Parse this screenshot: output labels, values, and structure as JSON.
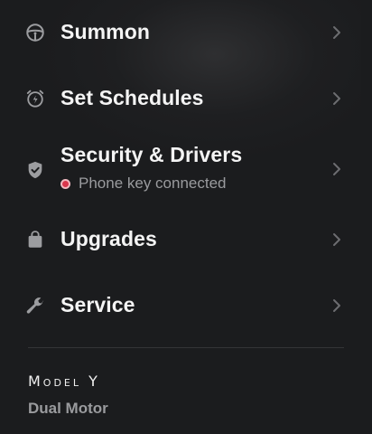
{
  "menu": {
    "items": [
      {
        "label": "Summon",
        "icon": "steering-wheel-icon"
      },
      {
        "label": "Set Schedules",
        "icon": "alarm-clock-bolt-icon"
      },
      {
        "label": "Security & Drivers",
        "icon": "shield-check-icon",
        "status": "Phone key connected",
        "status_color": "#d9364c"
      },
      {
        "label": "Upgrades",
        "icon": "shopping-bag-icon"
      },
      {
        "label": "Service",
        "icon": "wrench-icon"
      }
    ]
  },
  "vehicle": {
    "model": "Model Y",
    "variant": "Dual Motor"
  }
}
